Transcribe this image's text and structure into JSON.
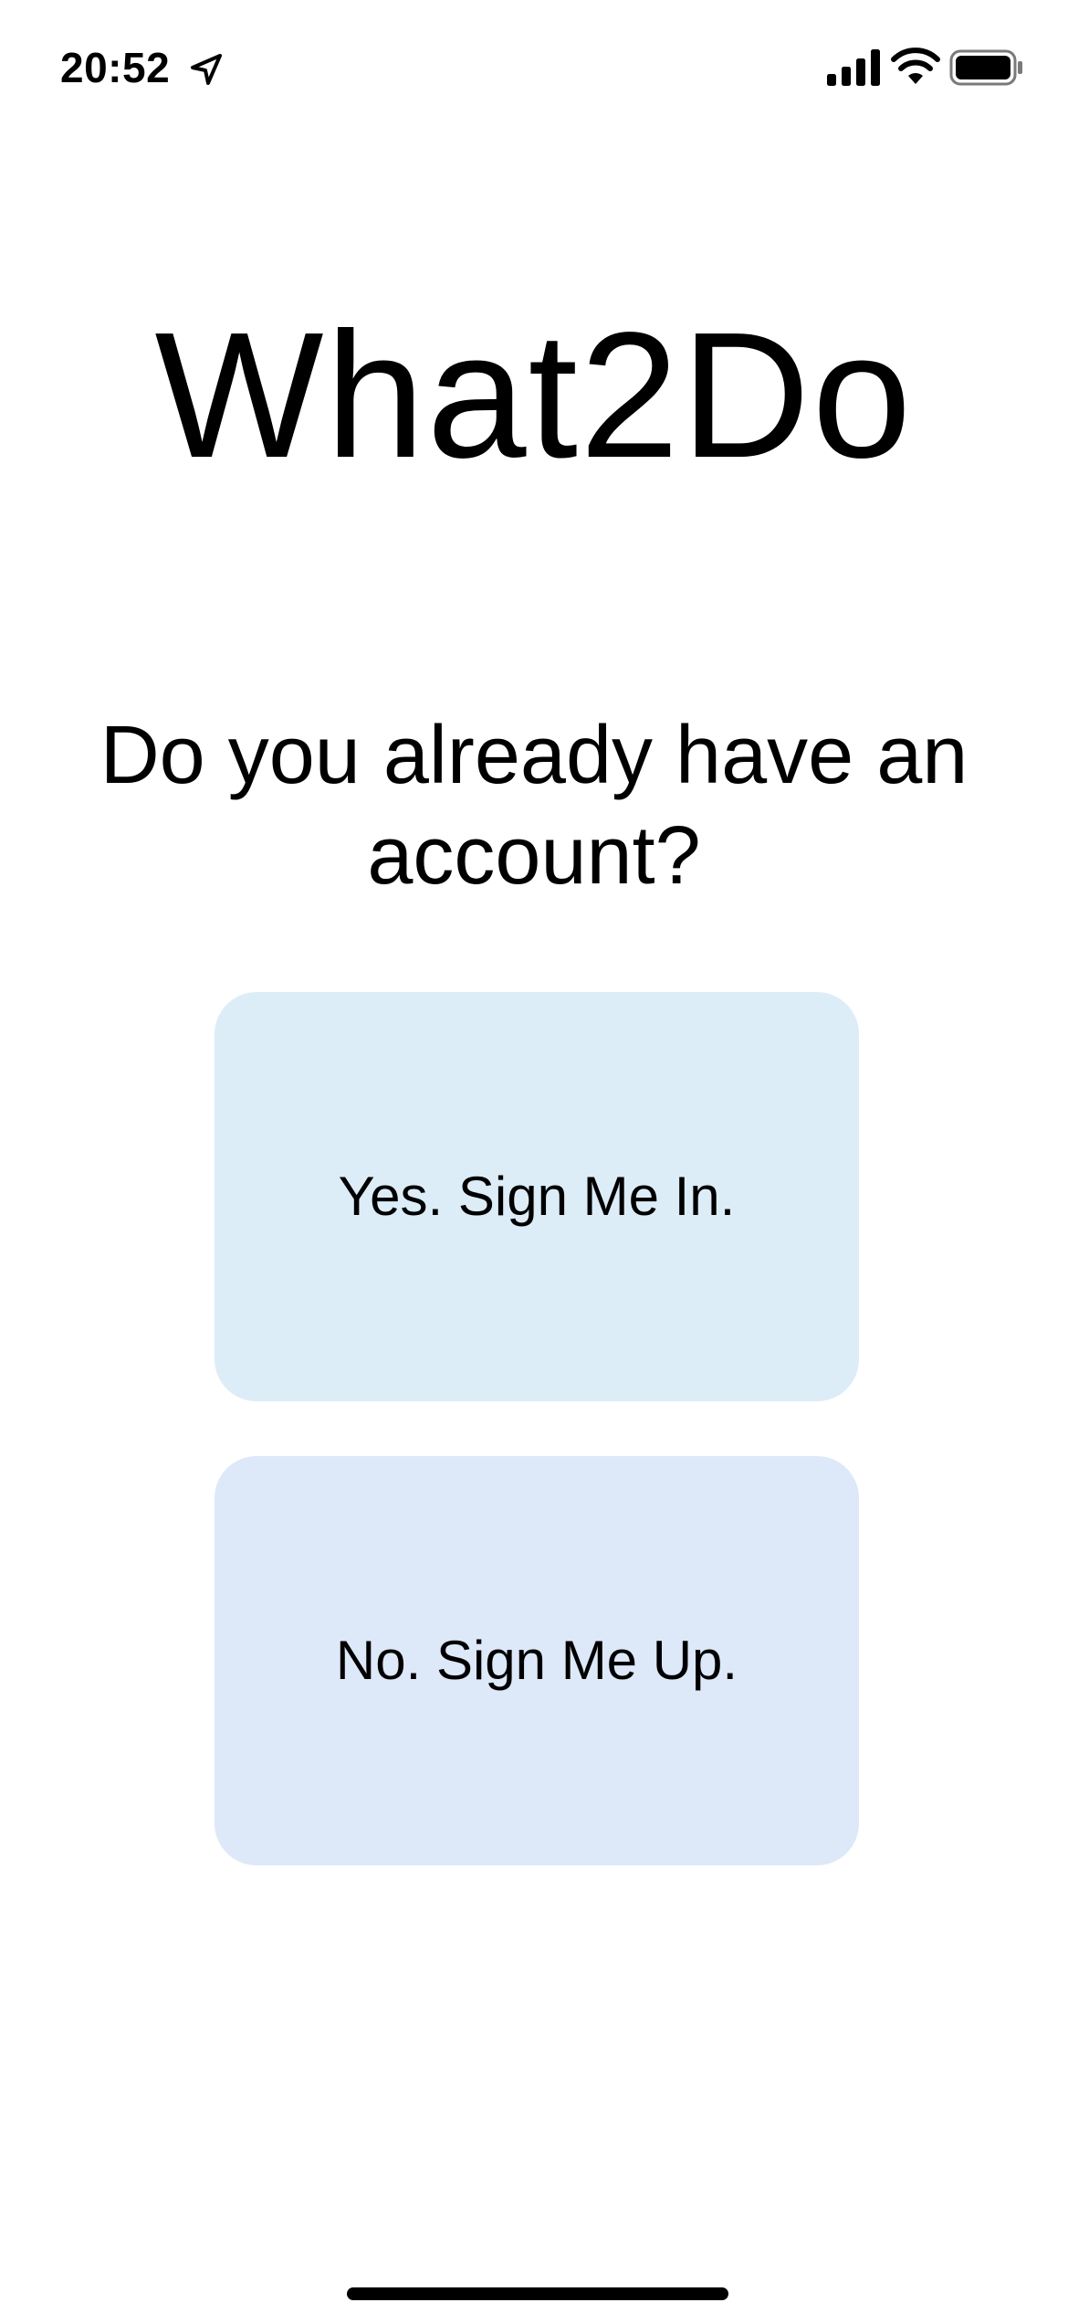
{
  "status_bar": {
    "time": "20:52",
    "icons": [
      "location-arrow-icon",
      "cellular-signal-icon",
      "wifi-icon",
      "battery-icon"
    ]
  },
  "app": {
    "title": "What2Do"
  },
  "prompt": {
    "question": "Do you already have an account?"
  },
  "options": {
    "sign_in_label": "Yes. Sign Me In.",
    "sign_up_label": "No. Sign Me Up."
  },
  "colors": {
    "background": "#ffffff",
    "sign_in_button": "#dcedf8",
    "sign_up_button": "#dde8f9",
    "text": "#000000"
  }
}
